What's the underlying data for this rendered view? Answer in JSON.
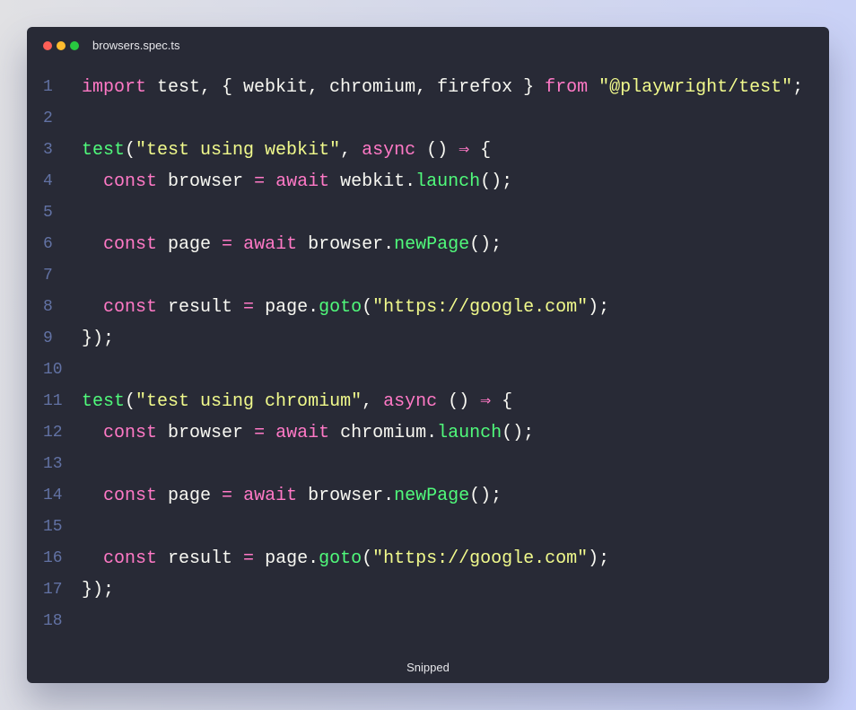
{
  "window": {
    "title": "browsers.spec.ts",
    "controls": [
      "close-dot",
      "minimize-dot",
      "maximize-dot"
    ],
    "footer_label": "Snipped"
  },
  "theme": {
    "background": "#282a36",
    "keyword": "#ff79c6",
    "function": "#50fa7b",
    "string": "#f1fa8c",
    "plain": "#f8f8f2",
    "line_number": "#6272a4"
  },
  "code": {
    "language": "typescript",
    "lines": [
      {
        "n": "1",
        "tokens": [
          [
            "kw",
            "import"
          ],
          [
            "plain",
            " test, { webkit, chromium, firefox } "
          ],
          [
            "kw",
            "from"
          ],
          [
            "plain",
            " "
          ],
          [
            "str",
            "\"@playwright/test\""
          ],
          [
            "plain",
            ";"
          ]
        ]
      },
      {
        "n": "2",
        "tokens": []
      },
      {
        "n": "3",
        "tokens": [
          [
            "fn",
            "test"
          ],
          [
            "plain",
            "("
          ],
          [
            "str",
            "\"test using webkit\""
          ],
          [
            "plain",
            ", "
          ],
          [
            "kw",
            "async"
          ],
          [
            "plain",
            " () "
          ],
          [
            "kw",
            "⇒"
          ],
          [
            "plain",
            " {"
          ]
        ]
      },
      {
        "n": "4",
        "tokens": [
          [
            "plain",
            "  "
          ],
          [
            "kw",
            "const"
          ],
          [
            "plain",
            " browser "
          ],
          [
            "kw",
            "="
          ],
          [
            "plain",
            " "
          ],
          [
            "kw",
            "await"
          ],
          [
            "plain",
            " webkit."
          ],
          [
            "fn",
            "launch"
          ],
          [
            "plain",
            "();"
          ]
        ]
      },
      {
        "n": "5",
        "tokens": []
      },
      {
        "n": "6",
        "tokens": [
          [
            "plain",
            "  "
          ],
          [
            "kw",
            "const"
          ],
          [
            "plain",
            " page "
          ],
          [
            "kw",
            "="
          ],
          [
            "plain",
            " "
          ],
          [
            "kw",
            "await"
          ],
          [
            "plain",
            " browser."
          ],
          [
            "fn",
            "newPage"
          ],
          [
            "plain",
            "();"
          ]
        ]
      },
      {
        "n": "7",
        "tokens": []
      },
      {
        "n": "8",
        "tokens": [
          [
            "plain",
            "  "
          ],
          [
            "kw",
            "const"
          ],
          [
            "plain",
            " result "
          ],
          [
            "kw",
            "="
          ],
          [
            "plain",
            " page."
          ],
          [
            "fn",
            "goto"
          ],
          [
            "plain",
            "("
          ],
          [
            "str",
            "\"https://google.com\""
          ],
          [
            "plain",
            ");"
          ]
        ]
      },
      {
        "n": "9",
        "tokens": [
          [
            "plain",
            "});"
          ]
        ]
      },
      {
        "n": "10",
        "tokens": []
      },
      {
        "n": "11",
        "tokens": [
          [
            "fn",
            "test"
          ],
          [
            "plain",
            "("
          ],
          [
            "str",
            "\"test using chromium\""
          ],
          [
            "plain",
            ", "
          ],
          [
            "kw",
            "async"
          ],
          [
            "plain",
            " () "
          ],
          [
            "kw",
            "⇒"
          ],
          [
            "plain",
            " {"
          ]
        ]
      },
      {
        "n": "12",
        "tokens": [
          [
            "plain",
            "  "
          ],
          [
            "kw",
            "const"
          ],
          [
            "plain",
            " browser "
          ],
          [
            "kw",
            "="
          ],
          [
            "plain",
            " "
          ],
          [
            "kw",
            "await"
          ],
          [
            "plain",
            " chromium."
          ],
          [
            "fn",
            "launch"
          ],
          [
            "plain",
            "();"
          ]
        ]
      },
      {
        "n": "13",
        "tokens": []
      },
      {
        "n": "14",
        "tokens": [
          [
            "plain",
            "  "
          ],
          [
            "kw",
            "const"
          ],
          [
            "plain",
            " page "
          ],
          [
            "kw",
            "="
          ],
          [
            "plain",
            " "
          ],
          [
            "kw",
            "await"
          ],
          [
            "plain",
            " browser."
          ],
          [
            "fn",
            "newPage"
          ],
          [
            "plain",
            "();"
          ]
        ]
      },
      {
        "n": "15",
        "tokens": []
      },
      {
        "n": "16",
        "tokens": [
          [
            "plain",
            "  "
          ],
          [
            "kw",
            "const"
          ],
          [
            "plain",
            " result "
          ],
          [
            "kw",
            "="
          ],
          [
            "plain",
            " page."
          ],
          [
            "fn",
            "goto"
          ],
          [
            "plain",
            "("
          ],
          [
            "str",
            "\"https://google.com\""
          ],
          [
            "plain",
            ");"
          ]
        ]
      },
      {
        "n": "17",
        "tokens": [
          [
            "plain",
            "});"
          ]
        ]
      },
      {
        "n": "18",
        "tokens": []
      }
    ]
  }
}
